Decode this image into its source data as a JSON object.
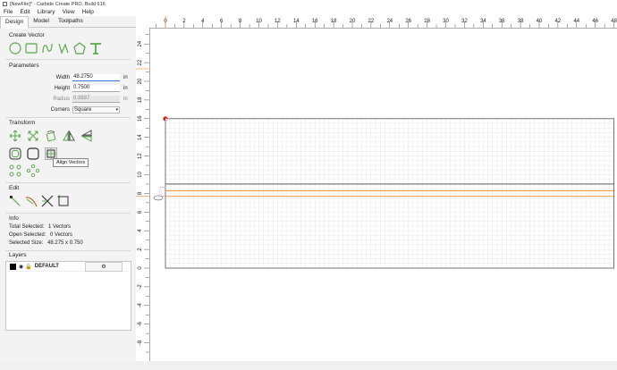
{
  "window": {
    "title": "[NewFile]* - Carbide Create PRO, Build 616"
  },
  "menu": [
    "File",
    "Edit",
    "Library",
    "View",
    "Help"
  ],
  "tabs": [
    "Design",
    "Model",
    "Toolpaths"
  ],
  "create_vector": {
    "title": "Create Vector",
    "icons": [
      "circle-icon",
      "rectangle-icon",
      "curve-icon",
      "polyline-icon",
      "polygon-icon",
      "text-icon"
    ]
  },
  "parameters": {
    "title": "Parameters",
    "width": {
      "label": "Width",
      "value": "48.2750",
      "unit": "in"
    },
    "height": {
      "label": "Height",
      "value": "0.7500",
      "unit": "in"
    },
    "radius": {
      "label": "Radius",
      "value": "0.3937",
      "unit": "in"
    },
    "corners": {
      "label": "Corners",
      "value": "Square"
    }
  },
  "transform": {
    "title": "Transform",
    "tooltip": "Align Vectors"
  },
  "edit": {
    "title": "Edit"
  },
  "info": {
    "title": "Info",
    "total_selected": "Total Selected:",
    "total_selected_value": "1 Vectors",
    "open_selected": "Open Selected:",
    "open_selected_value": "0 Vectors",
    "selected_size": "Selected Size:",
    "selected_size_value": "48.275 x 0.750"
  },
  "layers": {
    "title": "Layers",
    "items": [
      {
        "name": "DEFAULT",
        "color": "#000000"
      }
    ]
  },
  "ruler": {
    "x_ticks": [
      "0",
      "2",
      "4",
      "6",
      "8",
      "10",
      "12",
      "14",
      "16",
      "18",
      "20",
      "22",
      "24",
      "26",
      "28",
      "30",
      "32",
      "34",
      "36",
      "38",
      "40",
      "42",
      "44",
      "46",
      "48"
    ],
    "y_ticks": [
      "24",
      "22",
      "20",
      "18",
      "16",
      "14",
      "12",
      "10",
      "8",
      "6",
      "4",
      "2",
      "0",
      "-2",
      "-4",
      "-6",
      "-8"
    ]
  },
  "colors": {
    "accent_green": "#5aa84a",
    "selection_orange": "#f08a24",
    "origin_red": "#e02020",
    "handle_magenta": "#d040c0"
  }
}
